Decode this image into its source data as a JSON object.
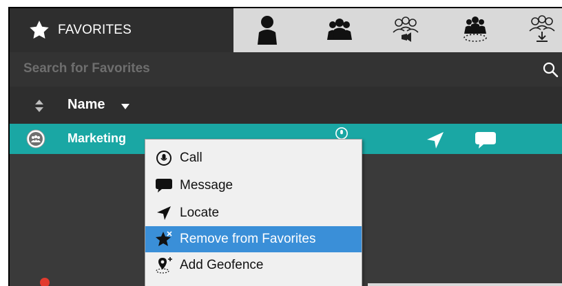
{
  "tabs": {
    "favorites_label": "FAVORITES",
    "icons": [
      "contact-icon",
      "group-icon",
      "broadcast-group-icon",
      "dynamic-group-icon",
      "download-group-icon"
    ]
  },
  "search": {
    "placeholder": "Search for Favorites"
  },
  "list_header": {
    "name_label": "Name"
  },
  "rows": [
    {
      "label": "Marketing"
    }
  ],
  "context_menu": {
    "items": [
      {
        "label": "Call",
        "icon": "call-icon"
      },
      {
        "label": "Message",
        "icon": "message-icon"
      },
      {
        "label": "Locate",
        "icon": "locate-icon"
      },
      {
        "label": "Remove from Favorites",
        "icon": "remove-favorite-icon",
        "selected": true
      },
      {
        "label": "Add Geofence",
        "icon": "geofence-icon"
      }
    ]
  },
  "colors": {
    "selected_row": "#1aa7a4",
    "menu_highlight": "#3a8fd8",
    "panel_bg": "#3a3a3a"
  }
}
